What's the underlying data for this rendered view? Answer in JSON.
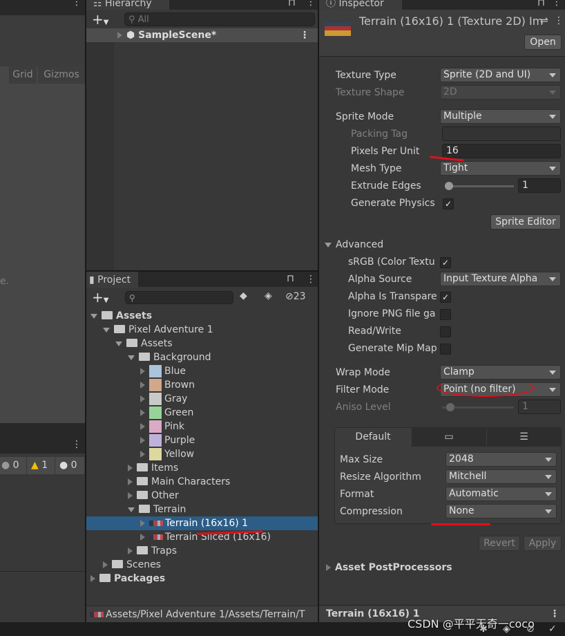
{
  "scene": {
    "grid": "Grid",
    "gizmos": "Gizmos",
    "partial_text": "e.",
    "console_counts": {
      "info": "0",
      "warning": "1",
      "error": "0"
    }
  },
  "hierarchy": {
    "title": "Hierarchy",
    "search_placeholder": "All",
    "scene": "SampleScene*"
  },
  "project": {
    "title": "Project",
    "hidden_count": "23",
    "tree": [
      {
        "label": "Assets",
        "depth": 0,
        "open": true,
        "bold": true,
        "kind": "folder"
      },
      {
        "label": "Pixel Adventure 1",
        "depth": 1,
        "open": true,
        "kind": "folder"
      },
      {
        "label": "Assets",
        "depth": 2,
        "open": true,
        "kind": "folder"
      },
      {
        "label": "Background",
        "depth": 3,
        "open": true,
        "kind": "folder"
      },
      {
        "label": "Blue",
        "depth": 4,
        "kind": "swatch",
        "color": "#a9c4dc"
      },
      {
        "label": "Brown",
        "depth": 4,
        "kind": "swatch",
        "color": "#d1a88a"
      },
      {
        "label": "Gray",
        "depth": 4,
        "kind": "swatch",
        "color": "#c9c9c9"
      },
      {
        "label": "Green",
        "depth": 4,
        "kind": "swatch",
        "color": "#96d49a"
      },
      {
        "label": "Pink",
        "depth": 4,
        "kind": "swatch",
        "color": "#dbaac5"
      },
      {
        "label": "Purple",
        "depth": 4,
        "kind": "swatch",
        "color": "#bdb2db"
      },
      {
        "label": "Yellow",
        "depth": 4,
        "kind": "swatch",
        "color": "#ddd8a0"
      },
      {
        "label": "Items",
        "depth": 3,
        "kind": "folder"
      },
      {
        "label": "Main Characters",
        "depth": 3,
        "kind": "folder"
      },
      {
        "label": "Other",
        "depth": 3,
        "kind": "folder"
      },
      {
        "label": "Terrain",
        "depth": 3,
        "open": true,
        "kind": "folder"
      },
      {
        "label": "Terrain (16x16) 1",
        "depth": 4,
        "kind": "texture",
        "selected": true
      },
      {
        "label": "Terrain Sliced (16x16)",
        "depth": 4,
        "kind": "texture"
      },
      {
        "label": "Traps",
        "depth": 3,
        "kind": "folder"
      },
      {
        "label": "Scenes",
        "depth": 1,
        "kind": "folder"
      },
      {
        "label": "Packages",
        "depth": 0,
        "bold": true,
        "kind": "folder"
      }
    ],
    "path": "Assets/Pixel Adventure 1/Assets/Terrain/T"
  },
  "inspector": {
    "title": "Inspector",
    "asset_title": "Terrain (16x16) 1 (Texture 2D) Im",
    "open": "Open",
    "texture_type": {
      "label": "Texture Type",
      "value": "Sprite (2D and UI)"
    },
    "texture_shape": {
      "label": "Texture Shape",
      "value": "2D"
    },
    "sprite_mode": {
      "label": "Sprite Mode",
      "value": "Multiple"
    },
    "packing_tag": {
      "label": "Packing Tag",
      "value": ""
    },
    "ppu": {
      "label": "Pixels Per Unit",
      "value": "16"
    },
    "mesh_type": {
      "label": "Mesh Type",
      "value": "Tight"
    },
    "extrude": {
      "label": "Extrude Edges",
      "value": "1"
    },
    "gen_physics": {
      "label": "Generate Physics",
      "checked": true
    },
    "sprite_editor": "Sprite Editor",
    "advanced": "Advanced",
    "srgb": {
      "label": "sRGB (Color Textu",
      "checked": true
    },
    "alpha_source": {
      "label": "Alpha Source",
      "value": "Input Texture Alpha"
    },
    "alpha_transparency": {
      "label": "Alpha Is Transpare",
      "checked": true
    },
    "ignore_png": {
      "label": "Ignore PNG file ga",
      "checked": false
    },
    "read_write": {
      "label": "Read/Write",
      "checked": false
    },
    "mipmaps": {
      "label": "Generate Mip Map",
      "checked": false
    },
    "wrap_mode": {
      "label": "Wrap Mode",
      "value": "Clamp"
    },
    "filter_mode": {
      "label": "Filter Mode",
      "value": "Point (no filter)"
    },
    "aniso": {
      "label": "Aniso Level",
      "value": "1"
    },
    "platform_tabs": {
      "default": "Default",
      "icons": [
        "monitor-icon",
        "server-icon"
      ]
    },
    "max_size": {
      "label": "Max Size",
      "value": "2048"
    },
    "resize": {
      "label": "Resize Algorithm",
      "value": "Mitchell"
    },
    "format": {
      "label": "Format",
      "value": "Automatic"
    },
    "compression": {
      "label": "Compression",
      "value": "None"
    },
    "revert": "Revert",
    "apply": "Apply",
    "postprocessors": "Asset PostProcessors",
    "footer": "Terrain (16x16) 1"
  },
  "watermark": "CSDN @平平无奇一coco",
  "colors": {
    "selection": "#2c5d87",
    "annotation": "#e0101a"
  }
}
